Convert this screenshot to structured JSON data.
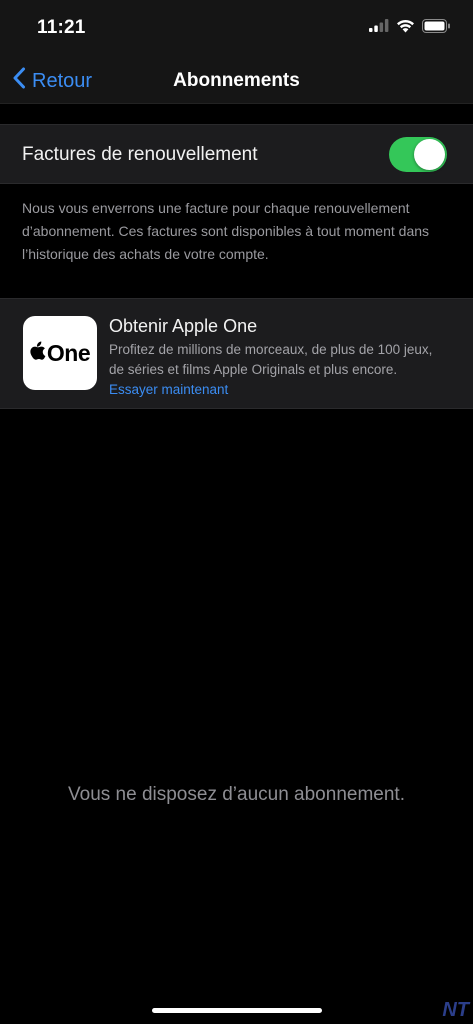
{
  "status_bar": {
    "time": "11:21"
  },
  "nav": {
    "back_label": "Retour",
    "title": "Abonnements"
  },
  "renewal": {
    "label": "Factures de renouvellement",
    "enabled": true,
    "footnote": "Nous vous enverrons une facture pour chaque renouvellement d’abonnement. Ces factures sont disponibles à tout moment dans l’historique des achats de votre compte."
  },
  "promo": {
    "logo_text": "One",
    "title": "Obtenir Apple One",
    "description": "Profitez de millions de morceaux, de plus de 100 jeux, de séries et films Apple Originals et plus encore.",
    "link": "Essayer maintenant"
  },
  "empty_state": "Vous ne disposez d’aucun abonnement.",
  "watermark": "NT",
  "colors": {
    "accent": "#3b8df3",
    "toggle_on": "#34c759",
    "background": "#000000",
    "cell": "#1c1c1e"
  },
  "icons": [
    "signal-icon",
    "wifi-icon",
    "battery-icon",
    "chevron-left-icon",
    "apple-logo-icon"
  ]
}
